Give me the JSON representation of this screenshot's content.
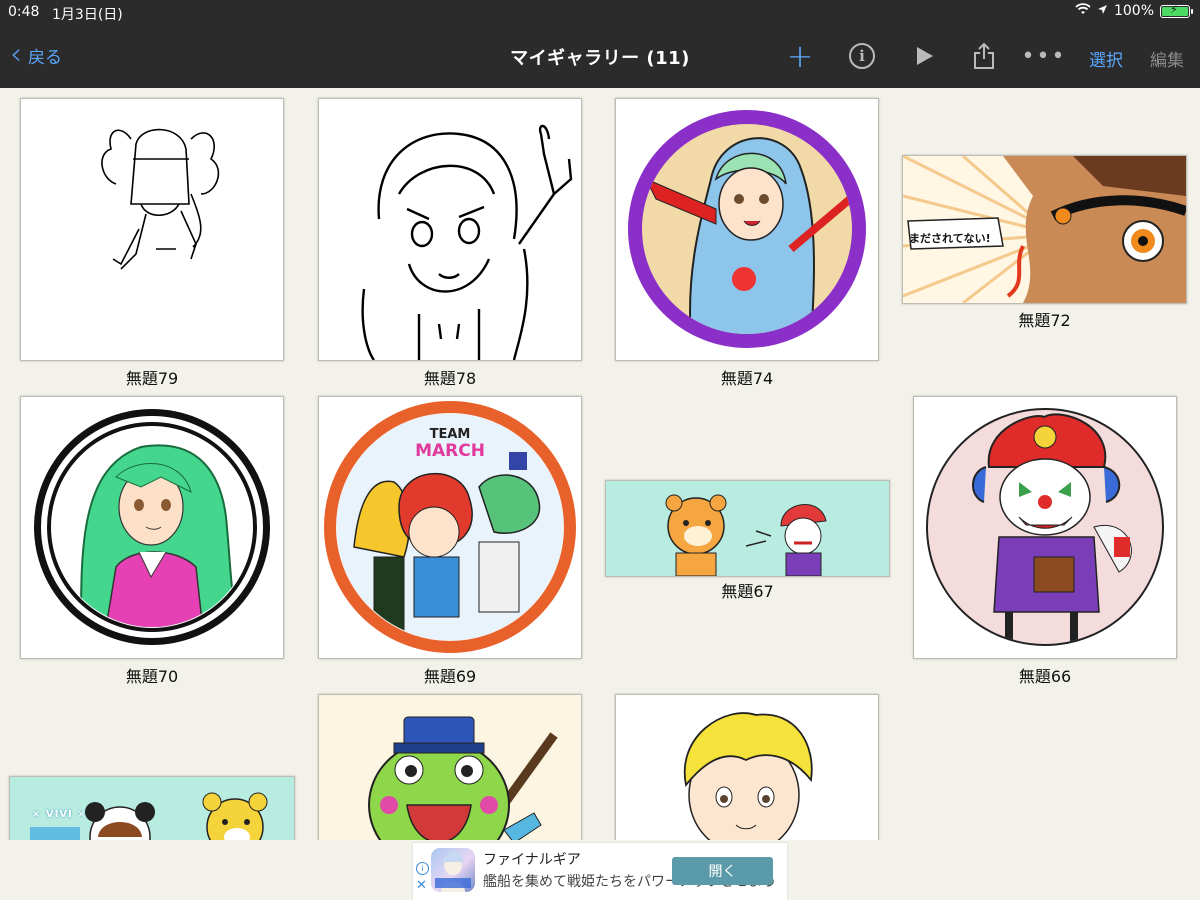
{
  "status_bar": {
    "time": "0:48",
    "date": "1月3日(日)",
    "battery": "100%",
    "battery_level": 1.0
  },
  "nav": {
    "back_label": "戻る",
    "title": "マイギャラリー (11)",
    "select_label": "選択",
    "edit_label": "編集"
  },
  "gallery": {
    "items": [
      {
        "title": "無題79",
        "kind": "sketch-girl"
      },
      {
        "title": "無題78",
        "kind": "sketch-hoodie"
      },
      {
        "title": "無題74",
        "kind": "purple-circle"
      },
      {
        "title": "無題72",
        "kind": "manga-panel",
        "speech": "まだされてない!"
      },
      {
        "title": "無題70",
        "kind": "green-hair-circle"
      },
      {
        "title": "無題69",
        "kind": "team-circle",
        "team_line1": "TEAM",
        "team_line2": "MARCH"
      },
      {
        "title": "無題67",
        "kind": "banner-bear"
      },
      {
        "title": "無題66",
        "kind": "clown-circle"
      },
      {
        "title": "",
        "kind": "banner-panda",
        "banner_text": "× VIVI ×"
      },
      {
        "title": "",
        "kind": "frog"
      },
      {
        "title": "",
        "kind": "blond-boy"
      }
    ]
  },
  "ad": {
    "title": "ファイナルギア",
    "subtitle": "艦船を集めて戦姫たちをパワーアップさせよう",
    "open_label": "開く"
  },
  "colors": {
    "accent": "#5aa8ff",
    "bar": "#2b2b2b",
    "background": "#f3f2ea",
    "battery": "#4cd964"
  }
}
